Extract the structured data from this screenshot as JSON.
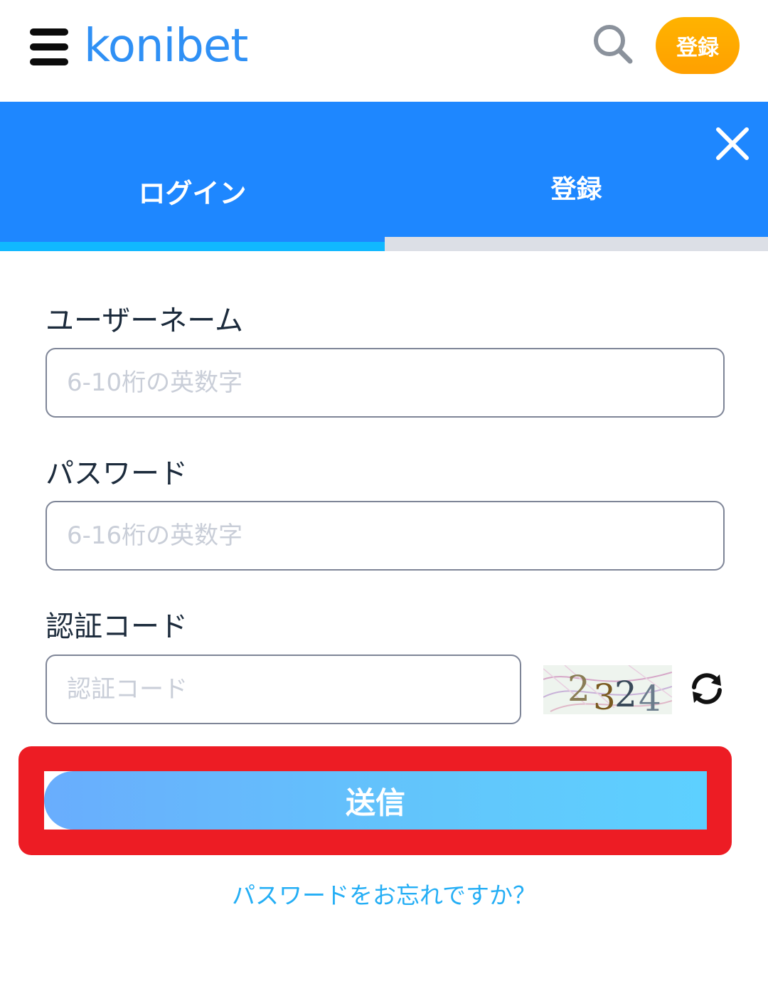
{
  "header": {
    "logo_text": "konibet",
    "register_label": "登録",
    "brand_color": "#2f90f5",
    "register_color": "#ffa800"
  },
  "tabs": {
    "login_label": "ログイン",
    "register_label": "登録",
    "active": "login",
    "background": "#1e87ff"
  },
  "form": {
    "username": {
      "label": "ユーザーネーム",
      "placeholder": "6-10桁の英数字",
      "value": ""
    },
    "password": {
      "label": "パスワード",
      "placeholder": "6-16桁の英数字",
      "value": ""
    },
    "captcha": {
      "label": "認証コード",
      "placeholder": "認証コード",
      "value": "",
      "image_text": "2324"
    },
    "submit_label": "送信",
    "forgot_link": "パスワードをお忘れですか？"
  },
  "icons": [
    "hamburger-icon",
    "search-icon",
    "close-icon",
    "refresh-icon"
  ],
  "highlight_color": "#ed1c24"
}
